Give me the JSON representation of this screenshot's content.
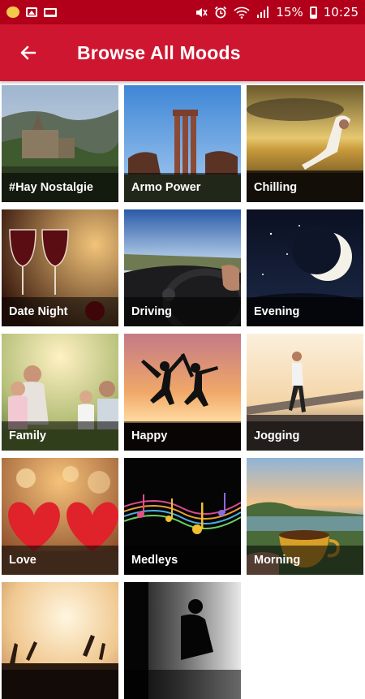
{
  "status_bar": {
    "notification_icons": [
      "chat-bubble-icon",
      "gallery-icon",
      "laptop-icon"
    ],
    "system_icons": [
      "mute-icon",
      "alarm-icon",
      "wifi-icon",
      "signal-icon"
    ],
    "battery_percent": "15%",
    "time": "10:25"
  },
  "header": {
    "back_icon": "arrow-left-icon",
    "title": "Browse All Moods",
    "color": "#cf1630"
  },
  "moods": [
    {
      "label": "#Hay Nostalgie"
    },
    {
      "label": "Armo Power"
    },
    {
      "label": "Chilling"
    },
    {
      "label": "Date Night"
    },
    {
      "label": "Driving"
    },
    {
      "label": "Evening"
    },
    {
      "label": "Family"
    },
    {
      "label": "Happy"
    },
    {
      "label": "Jogging"
    },
    {
      "label": "Love"
    },
    {
      "label": "Medleys"
    },
    {
      "label": "Morning"
    },
    {
      "label": ""
    },
    {
      "label": ""
    }
  ]
}
